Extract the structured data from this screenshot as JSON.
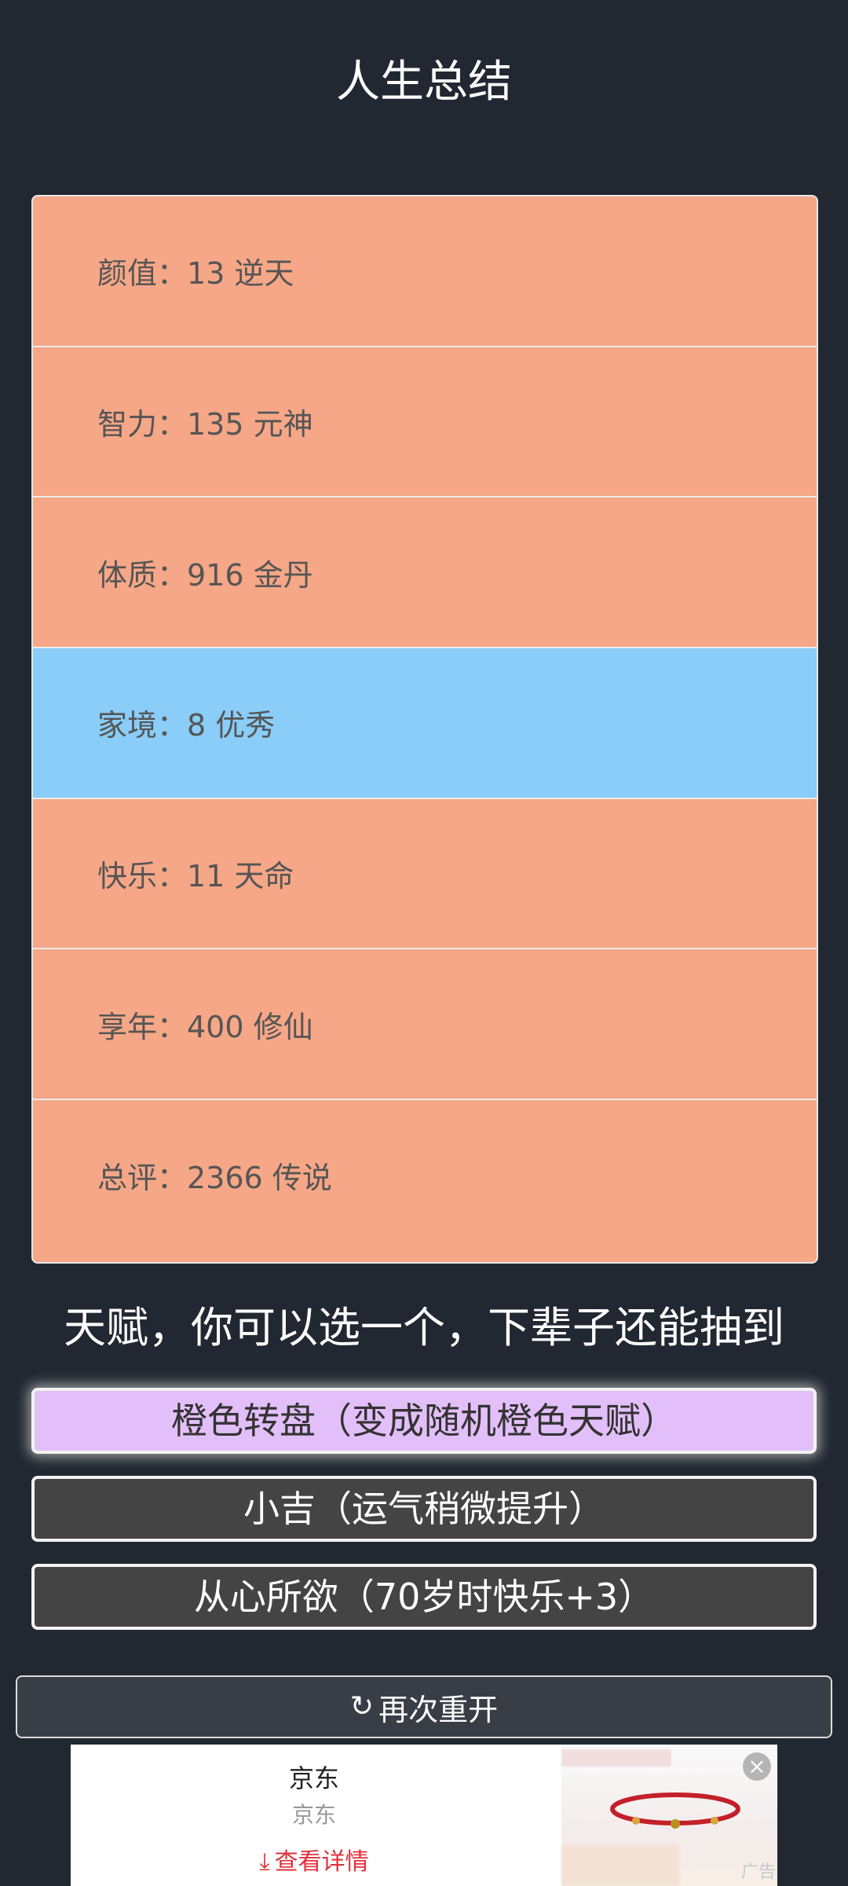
{
  "title": "人生总结",
  "stats": [
    {
      "label": "颜值：13 逆天"
    },
    {
      "label": "智力：135 元神"
    },
    {
      "label": "体质：916 金丹"
    },
    {
      "label": "家境：8 优秀"
    },
    {
      "label": "快乐：11 天命"
    },
    {
      "label": "享年：400 修仙"
    },
    {
      "label": "总评：2366 传说"
    }
  ],
  "talent_heading": "天赋，你可以选一个，下辈子还能抽到",
  "talents": [
    {
      "label": "橙色转盘（变成随机橙色天赋）",
      "selected": true
    },
    {
      "label": "小吉（运气稍微提升）",
      "selected": false
    },
    {
      "label": "从心所欲（70岁时快乐+3）",
      "selected": false
    }
  ],
  "restart_label": "再次重开",
  "ad": {
    "name": "京东",
    "subtitle": "京东",
    "details_label": "查看详情",
    "tag": "广告"
  }
}
